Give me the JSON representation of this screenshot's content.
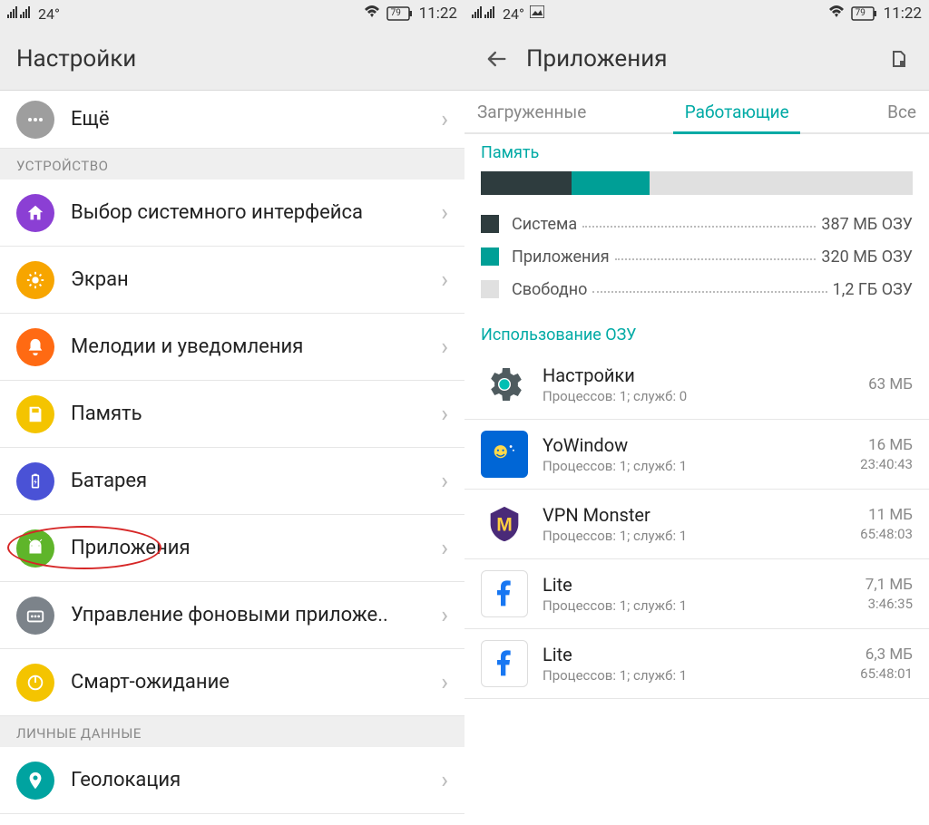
{
  "statusbar": {
    "temp": "24°",
    "battery": "79",
    "time": "11:22"
  },
  "left": {
    "title": "Настройки",
    "top_item": "Ещё",
    "section1": "УСТРОЙСТВО",
    "items": [
      {
        "label": "Выбор системного интерфейса",
        "color": "#8b3fd4",
        "icon": "home"
      },
      {
        "label": "Экран",
        "color": "#f7a500",
        "icon": "brightness"
      },
      {
        "label": "Мелодии и уведомления",
        "color": "#ff6a13",
        "icon": "bell"
      },
      {
        "label": "Память",
        "color": "#f4c400",
        "icon": "save"
      },
      {
        "label": "Батарея",
        "color": "#4a52d6",
        "icon": "battery"
      },
      {
        "label": "Приложения",
        "color": "#5fb52a",
        "icon": "android",
        "highlight": true
      },
      {
        "label": "Управление фоновыми приложе..",
        "color": "#7c838a",
        "icon": "apps"
      },
      {
        "label": "Смарт-ожидание",
        "color": "#f4c400",
        "icon": "power"
      }
    ],
    "section2": "ЛИЧНЫЕ ДАННЫЕ",
    "geo": {
      "label": "Геолокация",
      "color": "#00a3a0",
      "icon": "location"
    }
  },
  "right": {
    "title": "Приложения",
    "tabs": {
      "left": "Загруженные",
      "center": "Работающие",
      "right": "Все"
    },
    "memory": {
      "title": "Память",
      "bar": {
        "sys_pct": 21,
        "app_pct": 18
      },
      "rows": [
        {
          "swatch": "#2e3c3e",
          "label": "Система",
          "value": "387 МБ ОЗУ"
        },
        {
          "swatch": "#009f96",
          "label": "Приложения",
          "value": "320 МБ ОЗУ"
        },
        {
          "swatch": "#e0e0e0",
          "label": "Свободно",
          "value": "1,2 ГБ ОЗУ"
        }
      ]
    },
    "usage_title": "Использование ОЗУ",
    "apps": [
      {
        "name": "Настройки",
        "sub": "Процессов: 1; служб: 0",
        "size": "63 МБ",
        "time": "",
        "icon": "settings"
      },
      {
        "name": "YoWindow",
        "sub": "Процессов: 1; служб: 1",
        "size": "16 МБ",
        "time": "23:40:43",
        "icon": "yowindow"
      },
      {
        "name": "VPN Monster",
        "sub": "Процессов: 1; служб: 1",
        "size": "11 МБ",
        "time": "65:48:03",
        "icon": "vpn"
      },
      {
        "name": "Lite",
        "sub": "Процессов: 1; служб: 1",
        "size": "7,1 МБ",
        "time": "3:46:35",
        "icon": "facebook"
      },
      {
        "name": "Lite",
        "sub": "Процессов: 1; служб: 1",
        "size": "6,3 МБ",
        "time": "65:48:01",
        "icon": "facebook"
      }
    ]
  }
}
